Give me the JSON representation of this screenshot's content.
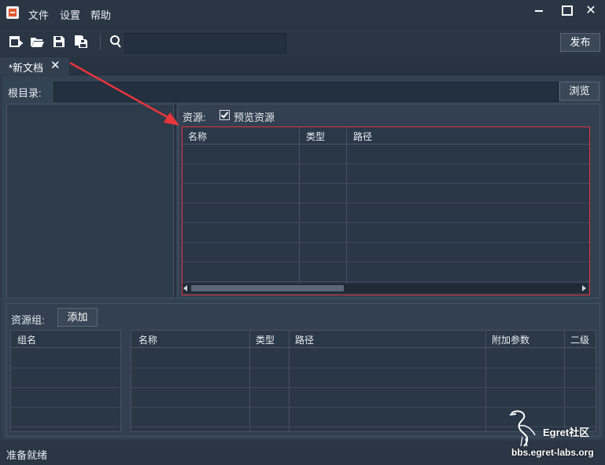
{
  "menu": {
    "file": "文件",
    "settings": "设置",
    "help": "帮助"
  },
  "window_controls": {
    "close": "✕"
  },
  "toolbar": {
    "publish_label": "发布",
    "search_placeholder": "",
    "icons": [
      "new-document-icon",
      "open-folder-icon",
      "save-icon",
      "save-all-icon",
      "search-icon"
    ]
  },
  "tabs": [
    {
      "label": "*新文档",
      "close": "✕"
    }
  ],
  "root_dir": {
    "label": "根目录:",
    "value": "",
    "browse_label": "浏览"
  },
  "resources": {
    "label": "资源:",
    "preview_label": "预览资源",
    "preview_checked": true,
    "columns": [
      "名称",
      "类型",
      "路径"
    ],
    "rows": []
  },
  "resource_groups": {
    "label": "资源组:",
    "add_label": "添加",
    "group_columns": [
      "组名"
    ],
    "detail_columns": [
      "名称",
      "类型",
      "路径",
      "附加参数",
      "二级"
    ],
    "rows": []
  },
  "status": {
    "text": "准备就绪"
  },
  "watermark": {
    "brand": "Egret社区",
    "url": "bbs.egret-labs.org"
  },
  "colors": {
    "highlight_border": "#e0333b",
    "annotation_arrow": "#e8353b",
    "background": "#2e3b4b"
  }
}
